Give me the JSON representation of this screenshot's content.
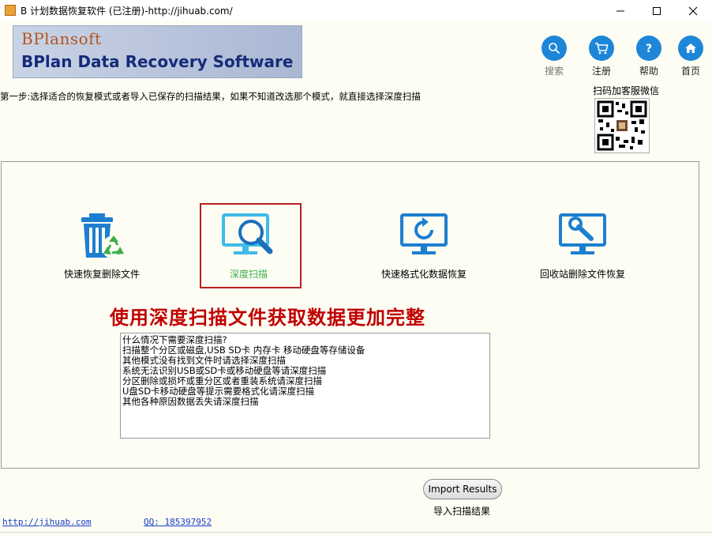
{
  "window": {
    "title": "B 计划数据恢复软件 (已注册)-http://jihuab.com/"
  },
  "banner": {
    "small_text": "BPlansoft",
    "main_text": "BPlan Data Recovery Software"
  },
  "nav": [
    {
      "label": "搜索",
      "icon": "search-icon"
    },
    {
      "label": "注册",
      "icon": "cart-icon"
    },
    {
      "label": "帮助",
      "icon": "help-icon"
    },
    {
      "label": "首页",
      "icon": "home-icon"
    }
  ],
  "step_text": "第一步:选择适合的恢复模式或者导入已保存的扫描结果，如果不知道改选那个模式，就直接选择深度扫描",
  "qr": {
    "label": "扫码加客服微信"
  },
  "modes": [
    {
      "label": "快速恢复删除文件",
      "icon": "trash-recycle-icon"
    },
    {
      "label": "深度扫描",
      "icon": "monitor-search-icon",
      "selected": true
    },
    {
      "label": "快速格式化数据恢复",
      "icon": "monitor-refresh-icon"
    },
    {
      "label": "回收站删除文件恢复",
      "icon": "monitor-wrench-icon"
    }
  ],
  "slogan": "使用深度扫描文件获取数据更加完整",
  "description_lines": [
    "什么情况下需要深度扫描?",
    "扫描整个分区或磁盘,USB SD卡 内存卡 移动硬盘等存储设备",
    " 其他模式没有找到文件时请选择深度扫描",
    "系统无法识别USB或SD卡或移动硬盘等请深度扫描",
    "分区删除或损坏或重分区或者重装系统请深度扫描",
    "U盘SD卡移动硬盘等提示需要格式化请深度扫描",
    "其他各种原因数据丢失请深度扫描"
  ],
  "import": {
    "button": "Import Results",
    "label": "导入扫描结果"
  },
  "footer": {
    "website": "http://jihuab.com",
    "qq": "QQ: 185397952"
  },
  "colors": {
    "accent_blue": "#1e86d8",
    "slogan_red": "#c00000",
    "selected_border": "#b52020",
    "background": "#fdfdf4"
  }
}
